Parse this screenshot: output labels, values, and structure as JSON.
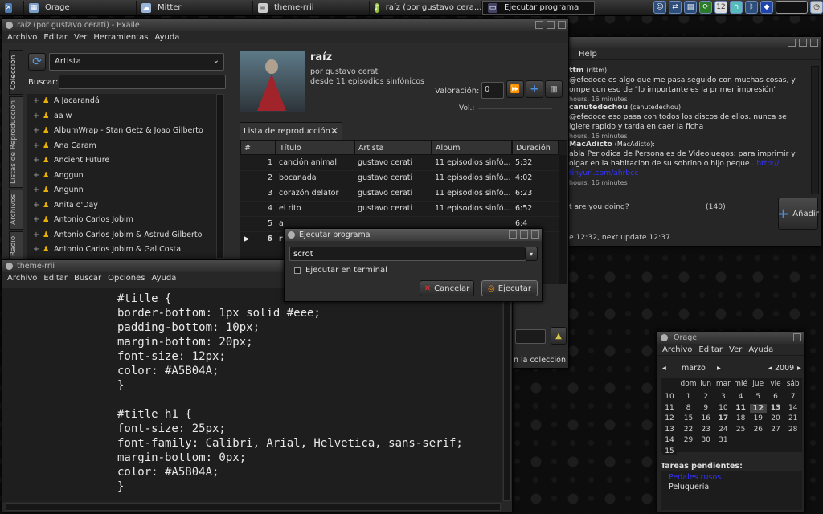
{
  "panel": {
    "tasks": [
      "Orage",
      "Mitter",
      "theme-rrii",
      "raíz (por gustavo cera...",
      "Ejecutar programa"
    ]
  },
  "exaile": {
    "title": "raíz (por gustavo cerati) - Exaile",
    "menu": [
      "Archivo",
      "Editar",
      "Ver",
      "Herramientas",
      "Ayuda"
    ],
    "side_tabs": [
      "Colección",
      "Listas de Reproducción",
      "Archivos",
      "Radio"
    ],
    "artist_combo": "Artista",
    "search_label": "Buscar:",
    "artists": [
      "A Jacarandá",
      "aa w",
      "AlbumWrap - Stan Getz & Joao Gilberto",
      "Ana Caram",
      "Ancient Future",
      "Anggun",
      "Angunn",
      "Anita o'Day",
      "Antonio Carlos Jobim",
      "Antonio Carlos Jobim & Astrud Gilberto",
      "Antonio Carlos Jobim & Gal Costa"
    ],
    "now_playing": {
      "title": "raíz",
      "by": "por gustavo cerati",
      "from": "desde 11 episodios sinfónicos"
    },
    "rating_label": "Valoración:",
    "rating_value": "0",
    "vol_label": "Vol.:",
    "playlist_tab": "Lista de reproducción",
    "columns": [
      "#",
      "Título",
      "Artista",
      "Album",
      "Duración"
    ],
    "rows": [
      {
        "n": "1",
        "t": "canción animal",
        "a": "gustavo cerati",
        "al": "11 episodios sinfó...",
        "d": "5:32"
      },
      {
        "n": "2",
        "t": "bocanada",
        "a": "gustavo cerati",
        "al": "11 episodios sinfó...",
        "d": "4:02"
      },
      {
        "n": "3",
        "t": "corazón delator",
        "a": "gustavo cerati",
        "al": "11 episodios sinfó...",
        "d": "6:23"
      },
      {
        "n": "4",
        "t": "el rito",
        "a": "gustavo cerati",
        "al": "11 episodios sinfó...",
        "d": "6:52"
      },
      {
        "n": "5",
        "t": "a",
        "a": "",
        "al": "",
        "d": "6:4"
      },
      {
        "n": "6",
        "t": "r",
        "a": "",
        "al": "",
        "d": ""
      }
    ],
    "collection_footer": "n la colección"
  },
  "mitter": {
    "menu": "Help",
    "posts": [
      {
        "name": "ttm",
        "handle": "(rittm)",
        "text": "@efedoce es algo que me pasa seguido con muchas cosas, y",
        "text2": "ompe con eso de \"lo importante es la primer impresión\"",
        "time": "hours, 16 minutes"
      },
      {
        "name": "canutedechou",
        "handle": "(canutedechou):",
        "text": "@efedoce eso pasa con todos los discos de ellos. nunca se",
        "text2": "igiere rapido y tarda en caer la ficha",
        "time": "hours, 16 minutes"
      },
      {
        "name": "MacAdicto",
        "handle": "(MacAdicto):",
        "text": "abla Periodica de Personajes de Videojuegos: para imprimir y",
        "text2": "olgar en la habitacion de su sobrino o hijo peque.. ",
        "link": "http://",
        "link2": "tinyurl.com/ahrbcc",
        "time": "hours, 16 minutes"
      }
    ],
    "status_prompt": "t are you doing?",
    "char_count": "(140)",
    "add_button": "Añadir",
    "update_text": "e 12:32, next update 12:37"
  },
  "theme": {
    "title": "theme-rrii",
    "menu": [
      "Archivo",
      "Editar",
      "Buscar",
      "Opciones",
      "Ayuda"
    ],
    "code": "#title {\nborder-bottom: 1px solid #eee;\npadding-bottom: 10px;\nmargin-bottom: 20px;\nfont-size: 12px;\ncolor: #A5B04A;\n}\n\n#title h1 {\nfont-size: 25px;\nfont-family: Calibri, Arial, Helvetica, sans-serif;\nmargin-bottom: 0px;\ncolor: #A5B04A;\n}"
  },
  "run": {
    "title": "Ejecutar programa",
    "command": "scrot",
    "terminal_label": "Ejecutar en terminal",
    "cancel": "Cancelar",
    "run": "Ejecutar"
  },
  "orage": {
    "title": "Orage",
    "menu": [
      "Archivo",
      "Editar",
      "Ver",
      "Ayuda"
    ],
    "month": "marzo",
    "year": "2009",
    "dow": [
      "dom",
      "lun",
      "mar",
      "mié",
      "jue",
      "vie",
      "sáb"
    ],
    "weeks": [
      {
        "wk": "10",
        "days": [
          "1",
          "2",
          "3",
          "4",
          "5",
          "6",
          "7"
        ]
      },
      {
        "wk": "11",
        "days": [
          "8",
          "9",
          "10",
          "11",
          "12",
          "13",
          "14"
        ]
      },
      {
        "wk": "12",
        "days": [
          "15",
          "16",
          "17",
          "18",
          "19",
          "20",
          "21"
        ]
      },
      {
        "wk": "13",
        "days": [
          "22",
          "23",
          "24",
          "25",
          "26",
          "27",
          "28"
        ]
      },
      {
        "wk": "14",
        "days": [
          "29",
          "30",
          "31",
          "",
          "",
          "",
          ""
        ]
      },
      {
        "wk": "15",
        "days": [
          "",
          "",
          "",
          "",
          "",
          "",
          ""
        ]
      }
    ],
    "today": "12",
    "bold_days": [
      "11",
      "13",
      "17"
    ],
    "tasks_label": "Tareas pendientes:",
    "tasks": [
      "Pedales rusos",
      "Peluquería"
    ]
  }
}
